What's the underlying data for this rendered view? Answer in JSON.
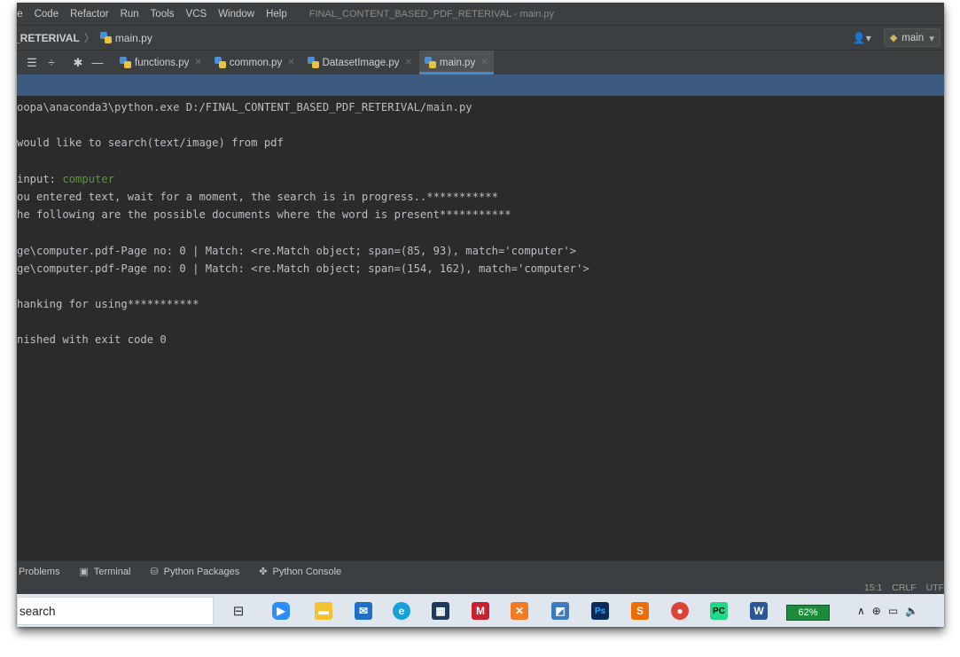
{
  "menubar": {
    "items": [
      "te",
      "Code",
      "Refactor",
      "Run",
      "Tools",
      "VCS",
      "Window",
      "Help"
    ],
    "window_title": "FINAL_CONTENT_BASED_PDF_RETERIVAL - main.py"
  },
  "navbar": {
    "project": "_RETERIVAL",
    "file": "main.py",
    "vcs_icon": "user-vcs-icon",
    "branch": "main"
  },
  "tabs": [
    {
      "label": "functions.py",
      "active": false
    },
    {
      "label": "common.py",
      "active": false
    },
    {
      "label": "DatasetImage.py",
      "active": false
    },
    {
      "label": "main.py",
      "active": true
    }
  ],
  "console": {
    "lines": [
      "oopa\\anaconda3\\python.exe D:/FINAL_CONTENT_BASED_PDF_RETERIVAL/main.py",
      "would like to search(text/image) from pdf",
      "input: ",
      "ou entered text, wait for a moment, the search is in progress..***********",
      "he following are the possible documents where the word is present***********",
      "ge\\computer.pdf-Page no: 0 | Match: <re.Match object; span=(85, 93), match='computer'>",
      "ge\\computer.pdf-Page no: 0 | Match: <re.Match object; span=(154, 162), match='computer'>",
      "hanking for using***********",
      "nished with exit code 0"
    ],
    "user_input": "computer"
  },
  "bottom_tools": [
    {
      "label": "Problems",
      "icon": "problems-icon"
    },
    {
      "label": "Terminal",
      "icon": "terminal-icon"
    },
    {
      "label": "Python Packages",
      "icon": "packages-icon"
    },
    {
      "label": "Python Console",
      "icon": "python-console-icon"
    }
  ],
  "status": {
    "position": "15:1",
    "line_ending": "CRLF",
    "encoding": "UTF"
  },
  "taskbar": {
    "search_text": "search",
    "battery": "62%",
    "colors": {
      "accent": "#4a88c7",
      "run_bar": "#3d5a80",
      "battery": "#1f8a3a"
    }
  }
}
